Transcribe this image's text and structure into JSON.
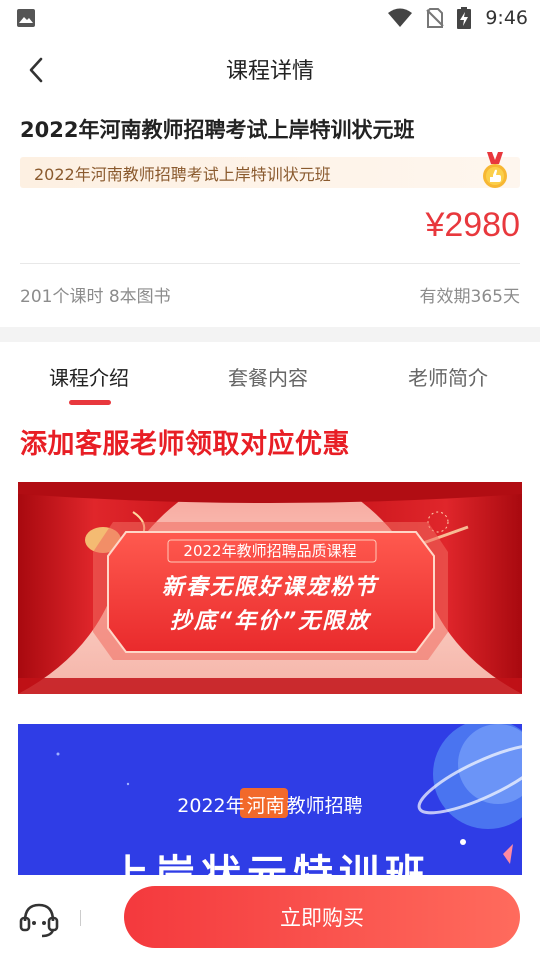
{
  "status_bar": {
    "time": "9:46"
  },
  "header": {
    "title": "课程详情"
  },
  "course": {
    "title": "2022年河南教师招聘考试上岸特训状元班",
    "banner_text": "2022年河南教师招聘考试上岸特训状元班",
    "price": "¥2980",
    "meta_left": "201个课时 8本图书",
    "meta_right": "有效期365天"
  },
  "tabs": [
    {
      "label": "课程介绍",
      "active": true
    },
    {
      "label": "套餐内容",
      "active": false
    },
    {
      "label": "老师简介",
      "active": false
    }
  ],
  "promo": {
    "heading": "添加客服老师领取对应优惠",
    "banner1": {
      "subtitle": "2022年教师招聘品质课程",
      "line1": "新春无限好课宠粉节",
      "line2": "抄底“年价”无限放"
    },
    "banner2": {
      "prefix": "2022年",
      "highlight": "河南",
      "suffix": "教师招聘",
      "headline": "上岸状元特训班"
    }
  },
  "bottom_bar": {
    "buy_label": "立即购买"
  },
  "colors": {
    "accent": "#e8383d",
    "promo_red": "#e81e25",
    "banner2_blue": "#2f3de6"
  },
  "icons": [
    "image-icon",
    "wifi-icon",
    "no-sim-icon",
    "battery-charging-icon",
    "back-arrow-icon",
    "medal-icon",
    "customer-service-icon"
  ]
}
